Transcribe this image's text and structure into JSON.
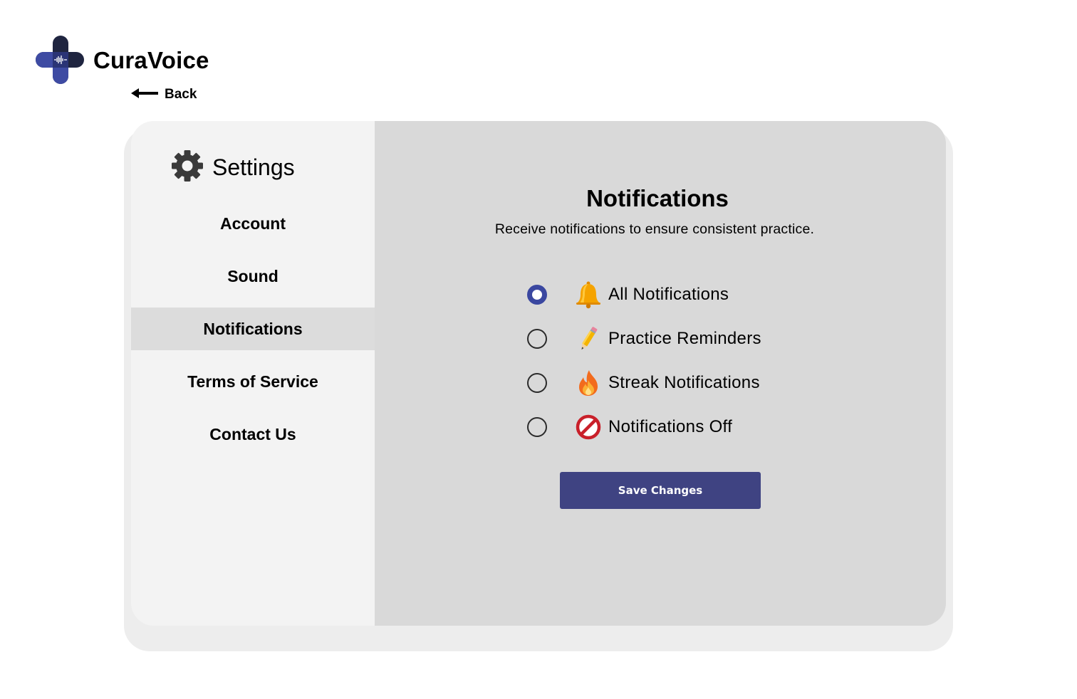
{
  "brand": {
    "name": "CuraVoice",
    "logo_icon": "medical-cross-waveform-icon"
  },
  "nav": {
    "back_label": "Back",
    "back_icon": "arrow-left-icon"
  },
  "sidebar": {
    "title": "Settings",
    "title_icon": "gear-icon",
    "items": [
      {
        "label": "Account",
        "active": false
      },
      {
        "label": "Sound",
        "active": false
      },
      {
        "label": "Notifications",
        "active": true
      },
      {
        "label": "Terms of Service",
        "active": false
      },
      {
        "label": "Contact Us",
        "active": false
      }
    ]
  },
  "main": {
    "title": "Notifications",
    "subtitle": "Receive notifications to ensure consistent practice.",
    "options": [
      {
        "label": "All Notifications",
        "icon": "bell-icon",
        "selected": true
      },
      {
        "label": "Practice Reminders",
        "icon": "pencil-icon",
        "selected": false
      },
      {
        "label": "Streak Notifications",
        "icon": "fire-icon",
        "selected": false
      },
      {
        "label": "Notifications Off",
        "icon": "prohibited-icon",
        "selected": false
      }
    ],
    "save_label": "Save Changes"
  },
  "colors": {
    "accent": "#3a47a0",
    "button": "#3f4382",
    "sidebar_bg": "#f3f3f3",
    "content_bg": "#d9d9d9",
    "active_item_bg": "#dcdcdc"
  }
}
